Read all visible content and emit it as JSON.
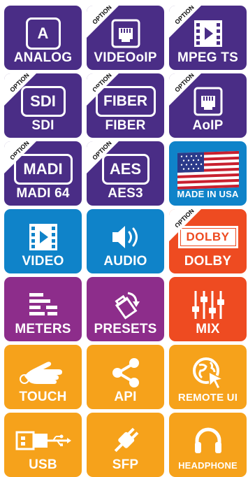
{
  "option_tag": "OPTION",
  "tiles": [
    {
      "label": "ANALOG",
      "icon_text": "A",
      "icon": "analog-box-icon",
      "color": "#4a2d86",
      "option": false
    },
    {
      "label": "VIDEOoIP",
      "icon": "network-port-icon",
      "color": "#4a2d86",
      "option": true
    },
    {
      "label": "MPEG TS",
      "icon": "film-play-icon",
      "color": "#4a2d86",
      "option": true
    },
    {
      "label": "SDI",
      "icon_text": "SDI",
      "icon": "sdi-box-icon",
      "color": "#4a2d86",
      "option": true
    },
    {
      "label": "FIBER",
      "icon_text": "FIBER",
      "icon": "fiber-box-icon",
      "color": "#4a2d86",
      "option": true
    },
    {
      "label": "AoIP",
      "icon": "network-port-icon",
      "color": "#4a2d86",
      "option": true
    },
    {
      "label": "MADI 64",
      "icon_text": "MADI",
      "icon": "madi-box-icon",
      "color": "#4a2d86",
      "option": true
    },
    {
      "label": "AES3",
      "icon_text": "AES",
      "icon": "aes-box-icon",
      "color": "#4a2d86",
      "option": true
    },
    {
      "label": "MADE IN USA",
      "icon": "us-flag-icon",
      "color": "#0f83c9",
      "option": false
    },
    {
      "label": "VIDEO",
      "icon": "film-play-icon",
      "color": "#0f83c9",
      "option": false
    },
    {
      "label": "AUDIO",
      "icon": "speaker-icon",
      "color": "#0f83c9",
      "option": false
    },
    {
      "label": "DOLBY",
      "icon_text": "DOLBY",
      "icon": "dolby-logo-icon",
      "color": "#ee4b21",
      "option": true
    },
    {
      "label": "METERS",
      "icon": "meters-bars-icon",
      "color": "#8d2d8b",
      "option": false
    },
    {
      "label": "PRESETS",
      "icon": "presets-tag-icon",
      "color": "#8d2d8b",
      "option": false
    },
    {
      "label": "MIX",
      "icon": "mixer-faders-icon",
      "color": "#ee4b21",
      "option": false
    },
    {
      "label": "TOUCH",
      "icon": "touch-hand-icon",
      "color": "#f6a21b",
      "option": false
    },
    {
      "label": "API",
      "icon": "share-nodes-icon",
      "color": "#f6a21b",
      "option": false
    },
    {
      "label": "REMOTE UI",
      "icon": "remote-globe-cursor-icon",
      "color": "#f6a21b",
      "option": false
    },
    {
      "label": "USB",
      "icon": "usb-plug-icon",
      "color": "#f6a21b",
      "option": false
    },
    {
      "label": "SFP",
      "icon": "power-plug-icon",
      "color": "#f6a21b",
      "option": false
    },
    {
      "label": "HEADPHONE",
      "icon": "headphone-icon",
      "color": "#f6a21b",
      "option": false
    }
  ]
}
